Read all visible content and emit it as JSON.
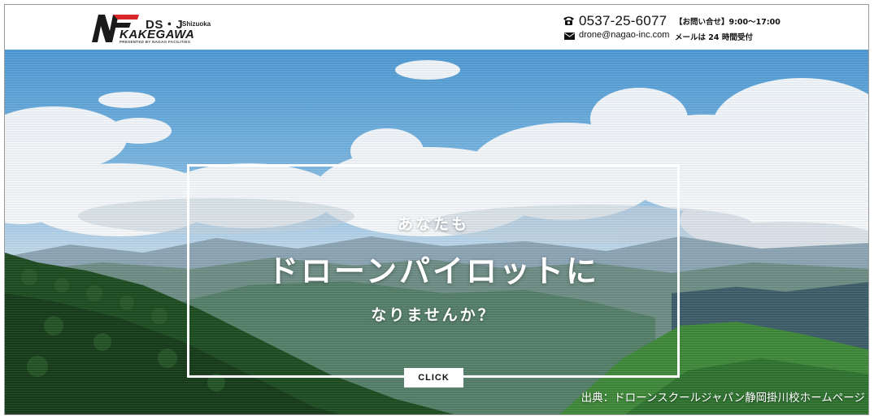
{
  "header": {
    "logo": {
      "ds_text": "DS・J",
      "region_text": "Shizuoka",
      "kakegawa_text": "KAKEGAWA",
      "presented_text": "PRESENTED BY NAGAO FACILITIES"
    },
    "contact": {
      "phone_icon": "phone-icon",
      "phone": "0537-25-6077",
      "hours": "【お問い合せ】9:00〜17:00",
      "mail_icon": "mail-icon",
      "email": "drone@nagao-inc.com",
      "mail_hours": "メールは 24 時間受付"
    }
  },
  "hero": {
    "line1": "あなたも",
    "line2": "ドローンパイロットに",
    "line3": "なりませんか？",
    "cta_label": "CLICK",
    "source_caption": "出典：ドローンスクールジャパン静岡掛川校ホームページ"
  },
  "colors": {
    "brand_red": "#d9262b",
    "brand_dark": "#1a1a1a",
    "text_white": "#ffffff"
  }
}
